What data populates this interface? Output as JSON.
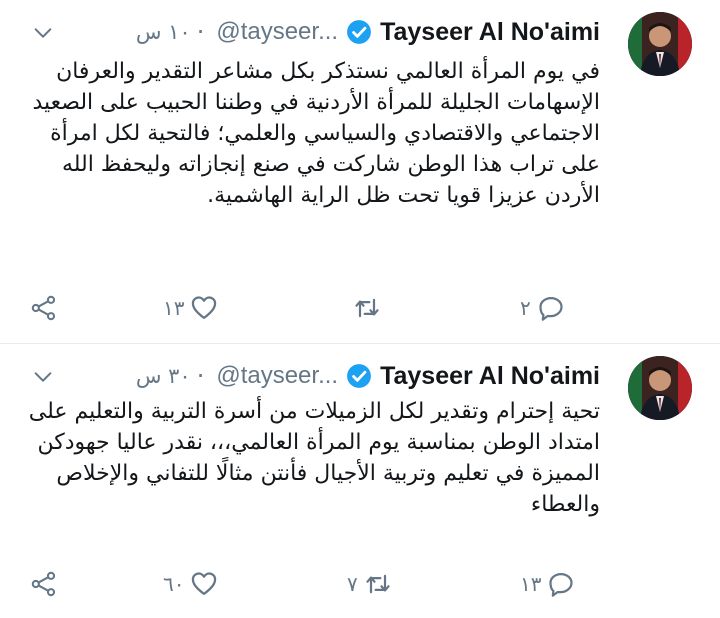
{
  "tweets": [
    {
      "author_name": "Tayseer Al No'aimi",
      "handle": "@tayseer...",
      "time": "١٠ س",
      "text": "في يوم المرأة العالمي نستذكر بكل مشاعر التقدير والعرفان الإسهامات الجليلة للمرأة الأردنية  في وطننا الحبيب على الصعيد الاجتماعي والاقتصادي والسياسي والعلمي؛ فالتحية لكل امرأة على تراب هذا الوطن شاركت في صنع إنجازاته وليحفظ الله الأردن عزيزا قويا تحت ظل الراية الهاشمية.",
      "reply_count": "٢",
      "retweet_count": "",
      "like_count": "١٣"
    },
    {
      "author_name": "Tayseer Al No'aimi",
      "handle": "@tayseer...",
      "time": "٣٠ س",
      "text": "تحية إحترام وتقدير لكل الزميلات من أسرة التربية والتعليم على امتداد الوطن بمناسبة يوم المرأة العالمي،،، نقدر عاليا جهودكن المميزة في تعليم وتربية الأجيال فأنتن مثالًا للتفاني والإخلاص والعطاء",
      "reply_count": "١٣",
      "retweet_count": "٧",
      "like_count": "٦٠"
    }
  ],
  "icons": {
    "verified": "verified-badge-icon",
    "caret": "chevron-down-icon",
    "reply": "reply-icon",
    "retweet": "retweet-icon",
    "like": "heart-icon",
    "share": "share-icon"
  },
  "colors": {
    "verified": "#1da1f2",
    "secondary_text": "#657786",
    "divider": "#e6ecf0"
  }
}
